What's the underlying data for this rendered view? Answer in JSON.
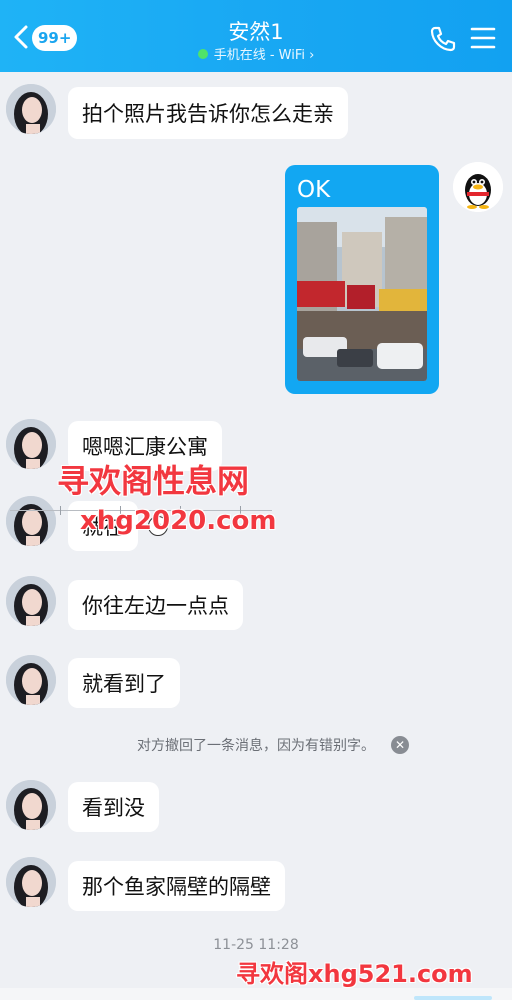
{
  "header": {
    "back_badge": "99+",
    "title": "安然1",
    "status": "手机在线 - WiFi ›",
    "icons": [
      "back-arrow-icon",
      "phone-icon",
      "menu-icon"
    ],
    "accent": "#1aa8f3"
  },
  "messages": [
    {
      "from": "other",
      "text": "拍个照片我告诉你怎么走亲"
    },
    {
      "from": "me",
      "text": "OK",
      "has_photo": true
    },
    {
      "from": "other",
      "text": "嗯嗯汇康公寓"
    },
    {
      "from": "other",
      "text": "就在"
    },
    {
      "from": "other",
      "text": "你往左边一点点"
    },
    {
      "from": "other",
      "text": "就看到了"
    },
    {
      "from": "other",
      "text": "看到没"
    },
    {
      "from": "other",
      "text": "那个鱼家隔壁的隔壁"
    }
  ],
  "system_message": "对方撤回了一条消息，因为有错别字。",
  "timestamp": "11-25 11:28",
  "watermarks": {
    "line1": "寻欢阁性息网",
    "line2": "xhg2020.com",
    "bottom": "寻欢阁xhg521.com"
  }
}
